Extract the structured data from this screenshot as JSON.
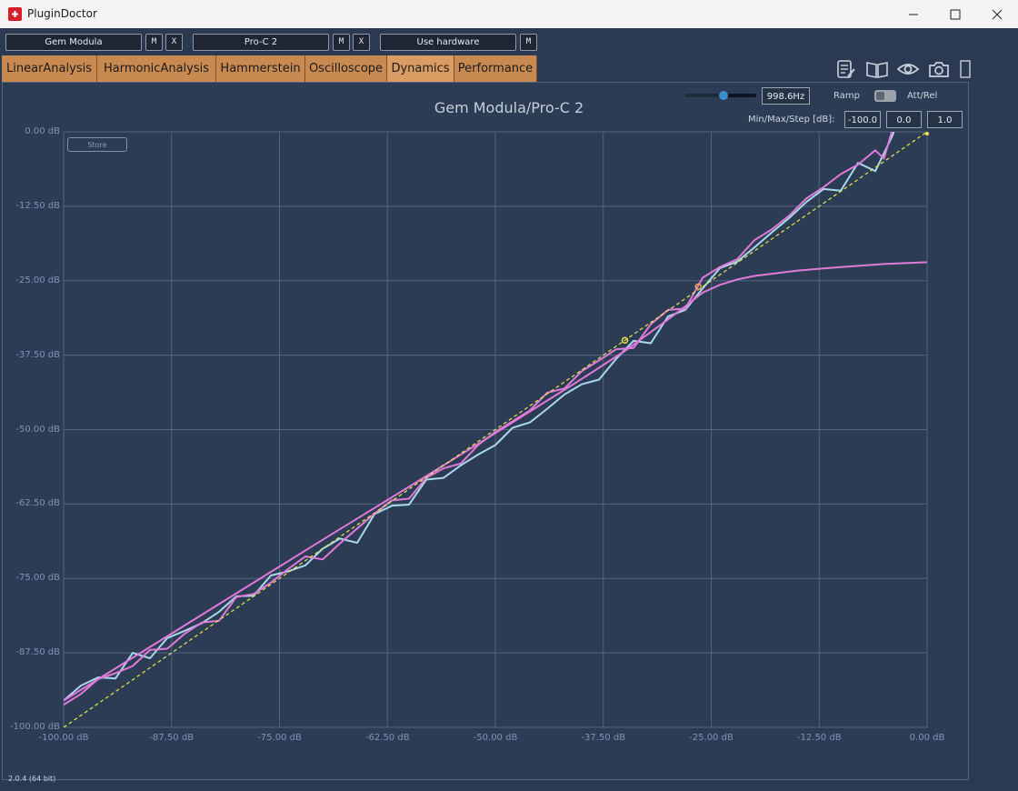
{
  "window": {
    "title": "PluginDoctor"
  },
  "plugin_slots": [
    {
      "name": "Gem Modula",
      "buttons": [
        "M",
        "X"
      ]
    },
    {
      "name": "Pro-C 2",
      "buttons": [
        "M",
        "X"
      ]
    },
    {
      "name": "Use hardware",
      "buttons": [
        "M"
      ]
    }
  ],
  "tabs": [
    "LinearAnalysis",
    "HarmonicAnalysis",
    "Hammerstein",
    "Oscilloscope",
    "Dynamics",
    "Performance"
  ],
  "active_tab": "Dynamics",
  "toolbar": {
    "icons": [
      "notes-icon",
      "book-icon",
      "eye-icon",
      "camera-icon",
      "panel-icon"
    ]
  },
  "controls": {
    "frequency": "998.6Hz",
    "ramp_label": "Ramp",
    "att_rel_label": "Att/Rel",
    "minmaxstep_label": "Min/Max/Step [dB]:",
    "min": "-100.0",
    "max": "0.0",
    "step": "1.0",
    "store_label": "Store"
  },
  "version": "2.0.4 (64 bit)",
  "colors": {
    "series_blue": "#a8d8ea",
    "series_pink": "#e07ad8",
    "reference": "#e6e64a",
    "grid": "#52647f"
  },
  "chart_data": {
    "type": "line",
    "title": "Gem Modula/Pro-C 2",
    "xlabel": "",
    "ylabel": "",
    "xlim": [
      -100,
      0
    ],
    "ylim": [
      -100,
      0
    ],
    "x_ticks": [
      "-100.00 dB",
      "-87.50 dB",
      "-75.00 dB",
      "-62.50 dB",
      "-50.00 dB",
      "-37.50 dB",
      "-25.00 dB",
      "-12.50 dB",
      "0.00 dB"
    ],
    "y_ticks": [
      "0.00 dB",
      "-12.50 dB",
      "-25.00 dB",
      "-37.50 dB",
      "-50.00 dB",
      "-62.50 dB",
      "-75.00 dB",
      "-87.50 dB",
      "-100.00 dB"
    ],
    "grid": true,
    "series": [
      {
        "style": "blue-noisy",
        "x": [
          -100,
          -98,
          -96,
          -94,
          -92,
          -90,
          -88,
          -86,
          -84,
          -82,
          -80,
          -78,
          -76,
          -74,
          -72,
          -70,
          -68,
          -66,
          -64,
          -62,
          -60,
          -58,
          -56,
          -54,
          -52,
          -50,
          -48,
          -46,
          -44,
          -42,
          -40,
          -38,
          -36,
          -34,
          -32,
          -30,
          -28,
          -26,
          -24,
          -22,
          -20,
          -18,
          -16,
          -14,
          -12,
          -10,
          -8,
          -6,
          -4,
          -3.5
        ],
        "y": [
          -95.5,
          -93.0,
          -91.6,
          -91.8,
          -87.5,
          -88.4,
          -85.0,
          -83.8,
          -82.5,
          -80.6,
          -78.0,
          -77.9,
          -74.5,
          -73.8,
          -72.8,
          -70.0,
          -68.3,
          -69.0,
          -64.2,
          -62.8,
          -62.6,
          -58.4,
          -58.1,
          -56.0,
          -54.2,
          -52.6,
          -49.7,
          -48.8,
          -46.5,
          -44.1,
          -42.4,
          -41.6,
          -38.1,
          -35.1,
          -35.5,
          -31.0,
          -29.9,
          -26.3,
          -22.9,
          -21.8,
          -19.4,
          -16.9,
          -14.5,
          -11.8,
          -9.6,
          -9.9,
          -5.2,
          -6.6,
          -0.6,
          1.5
        ]
      },
      {
        "style": "pink-noisy",
        "x": [
          -100,
          -98,
          -96,
          -94,
          -92,
          -90,
          -88,
          -86,
          -84,
          -82,
          -80,
          -78,
          -76,
          -74,
          -72,
          -70,
          -68,
          -66,
          -64,
          -62,
          -60,
          -58,
          -56,
          -54,
          -52,
          -50,
          -48,
          -46,
          -44,
          -42,
          -40,
          -38,
          -36,
          -34,
          -32,
          -30,
          -28,
          -26,
          -24,
          -22,
          -20,
          -18,
          -16,
          -14,
          -12,
          -10,
          -8,
          -6,
          -5,
          -4
        ],
        "y": [
          -96.2,
          -94.4,
          -91.9,
          -90.9,
          -89.7,
          -87.0,
          -86.8,
          -84.3,
          -82.4,
          -82.1,
          -78.1,
          -77.6,
          -75.7,
          -73.4,
          -71.3,
          -71.8,
          -69.1,
          -66.6,
          -64.1,
          -61.9,
          -61.6,
          -58.1,
          -56.5,
          -55.7,
          -52.6,
          -50.4,
          -48.6,
          -46.8,
          -43.8,
          -43.1,
          -40.2,
          -38.4,
          -36.5,
          -36.3,
          -32.3,
          -29.9,
          -29.7,
          -24.5,
          -22.7,
          -21.4,
          -18.2,
          -16.4,
          -14.1,
          -11.2,
          -9.3,
          -7.1,
          -5.5,
          -3.1,
          -4.5,
          0.5
        ]
      },
      {
        "style": "pink-compression",
        "x": [
          -100,
          -90,
          -80,
          -70,
          -60,
          -50,
          -40,
          -35,
          -30,
          -28,
          -26,
          -24,
          -22,
          -20,
          -15,
          -10,
          -5,
          0
        ],
        "y": [
          -95.5,
          -86.5,
          -77.5,
          -68.5,
          -59.6,
          -50.6,
          -41.5,
          -36.8,
          -31.5,
          -29.3,
          -27.0,
          -25.7,
          -24.8,
          -24.2,
          -23.3,
          -22.7,
          -22.2,
          -21.9
        ]
      },
      {
        "style": "reference-dashed",
        "x": [
          -100,
          0
        ],
        "y": [
          -100,
          0
        ]
      }
    ],
    "markers": [
      {
        "x": -35.0,
        "y": -35.0,
        "color": "#e6e64a"
      },
      {
        "x": -26.5,
        "y": -26.0,
        "color": "#f2b23a"
      }
    ]
  }
}
